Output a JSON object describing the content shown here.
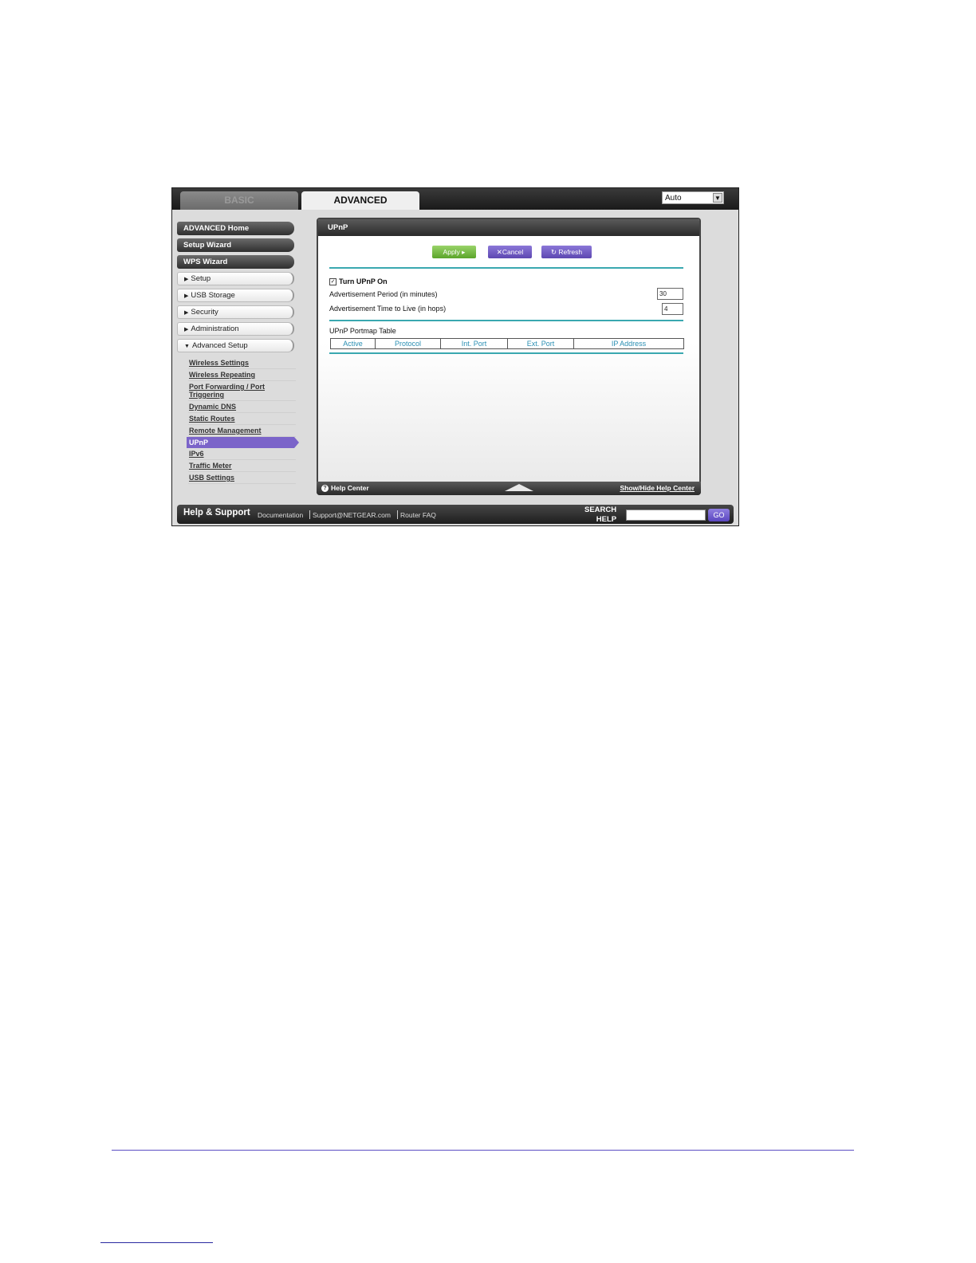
{
  "tabs": {
    "basic": "BASIC",
    "advanced": "ADVANCED"
  },
  "language_select": {
    "value": "Auto"
  },
  "sidebar": {
    "top_items": [
      "ADVANCED Home",
      "Setup Wizard",
      "WPS Wizard"
    ],
    "sections": [
      "Setup",
      "USB Storage",
      "Security",
      "Administration",
      "Advanced Setup"
    ],
    "submenu": [
      "Wireless Settings",
      "Wireless Repeating",
      "Port Forwarding / Port Triggering",
      "Dynamic DNS",
      "Static Routes",
      "Remote Management",
      "UPnP",
      "IPv6",
      "Traffic Meter",
      "USB Settings"
    ],
    "active_submenu": "UPnP"
  },
  "panel": {
    "title": "UPnP",
    "buttons": {
      "apply": "Apply ▸",
      "cancel": "✕Cancel",
      "refresh": "↻ Refresh"
    },
    "turn_upnp_on": {
      "label": "Turn UPnP On",
      "checked": true
    },
    "advertisement_period": {
      "label": "Advertisement Period (in minutes)",
      "value": "30"
    },
    "advertisement_ttl": {
      "label": "Advertisement Time to Live (in hops)",
      "value": "4"
    },
    "portmap_title": "UPnP Portmap Table",
    "portmap_columns": [
      "Active",
      "Protocol",
      "Int. Port",
      "Ext. Port",
      "IP Address"
    ]
  },
  "panel_footer": {
    "help_center": "Help Center",
    "show_hide": "Show/Hide Help Center"
  },
  "help_bar": {
    "title": "Help & Support",
    "links": [
      "Documentation",
      "Support@NETGEAR.com",
      "Router FAQ"
    ],
    "search_label_1": "SEARCH",
    "search_label_2": "HELP",
    "go": "GO"
  }
}
